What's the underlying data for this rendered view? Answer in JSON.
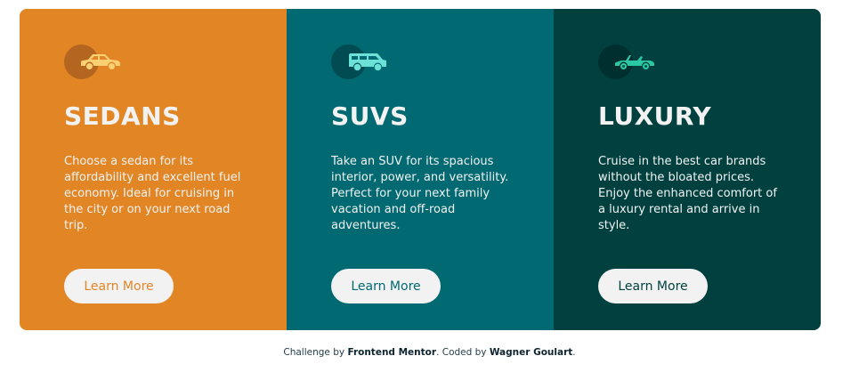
{
  "cards": [
    {
      "title": "SEDANS",
      "description": "Choose a sedan for its affordability and excellent fuel economy. Ideal for cruising in the city or on your next road trip.",
      "button_label": "Learn More",
      "icon": "sedan-car-icon",
      "accent_color": "#e28625"
    },
    {
      "title": "SUVS",
      "description": "Take an SUV for its spacious interior, power, and versatility. Perfect for your next family vacation and off-road adventures.",
      "button_label": "Learn More",
      "icon": "suv-car-icon",
      "accent_color": "#006971"
    },
    {
      "title": "LUXURY",
      "description": "Cruise in the best car brands without the bloated prices. Enjoy the enhanced comfort of a luxury rental and arrive in style.",
      "button_label": "Learn More",
      "icon": "luxury-car-icon",
      "accent_color": "#004140"
    }
  ],
  "attribution": {
    "prefix": "Challenge by ",
    "challenge_link": "Frontend Mentor",
    "middle": ". Coded by ",
    "author_link": "Wagner Goulart",
    "suffix": "."
  }
}
